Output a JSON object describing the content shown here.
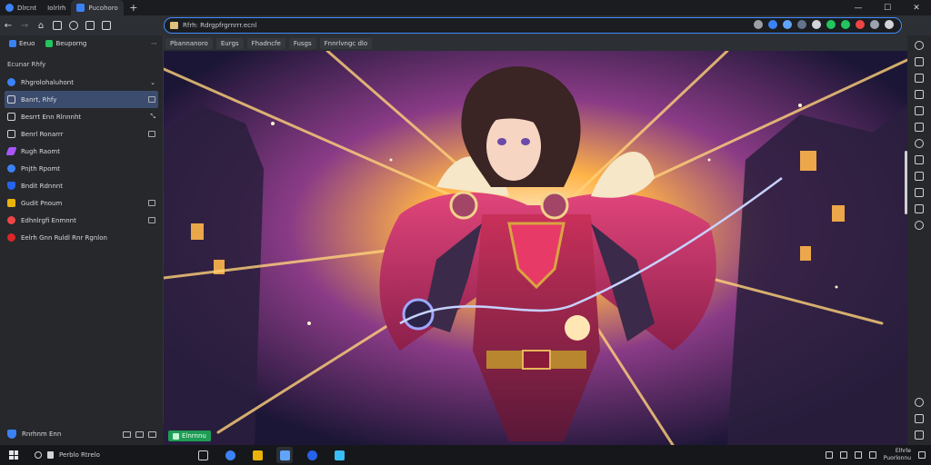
{
  "tabs": [
    {
      "label": "Dlrcnt",
      "active": false,
      "icon": "browser-icon"
    },
    {
      "label": "Iolrlrh",
      "active": false,
      "icon": "page-icon"
    },
    {
      "label": "Pucohoro",
      "active": true,
      "icon": "page-icon"
    }
  ],
  "omnibox": {
    "url": "Rfrh: Rdrgpfrgrnrrr.ecnl"
  },
  "bookmarks": [
    "Pbannanoro",
    "Eurgs",
    "Fhadncfe",
    "Fusgs",
    "Fnnrlvngc dlo"
  ],
  "sidebar": {
    "head_items": [
      "Eeuo",
      "Beuporng"
    ],
    "title": "Ecunar Rhfy",
    "items": [
      {
        "label": "Rhgrolohaluhont",
        "icon": "profile-icon",
        "color": "#3b82f6",
        "active": false,
        "trail": "chevron"
      },
      {
        "label": "Banrt, Rhfy",
        "icon": "bookmark-icon",
        "color": "#9aa0a6",
        "active": true,
        "trail": "box"
      },
      {
        "label": "Besrrt Enn Rlnnnht",
        "icon": "list-icon",
        "color": "#9aa0a6",
        "active": false,
        "trail": "expand"
      },
      {
        "label": "Benrl Ronarrr",
        "icon": "square-icon",
        "color": "#9aa0a6",
        "active": false,
        "trail": "box"
      },
      {
        "label": "Rugh Raomt",
        "icon": "feather-icon",
        "color": "#a855f7",
        "active": false,
        "trail": ""
      },
      {
        "label": "Pnjth Rpomt",
        "icon": "edge-icon",
        "color": "#3b82f6",
        "active": false,
        "trail": ""
      },
      {
        "label": "Bndit Rdnnnt",
        "icon": "shield-icon",
        "color": "#2563eb",
        "active": false,
        "trail": ""
      },
      {
        "label": "Gudit Pnoum",
        "icon": "star-icon",
        "color": "#eab308",
        "active": false,
        "trail": "box"
      },
      {
        "label": "Edhnlrgfi Enmnnt",
        "icon": "warning-icon",
        "color": "#ef4444",
        "active": false,
        "trail": "box"
      },
      {
        "label": "Eelrh Gnn Ruldl Rnr Rgnlon",
        "icon": "record-icon",
        "color": "#dc2626",
        "active": false,
        "trail": ""
      }
    ],
    "footer": "Rnrhnm Enn"
  },
  "content_badge": "Elnrnnu",
  "taskbar": {
    "search_text": "Perblo Rtrelo",
    "clock_time": "Elhrle",
    "clock_date": "Puorlonnu"
  },
  "colors": {
    "accent": "#3f8bff",
    "taskbar": "#16171a",
    "sidebar": "#26282c"
  }
}
